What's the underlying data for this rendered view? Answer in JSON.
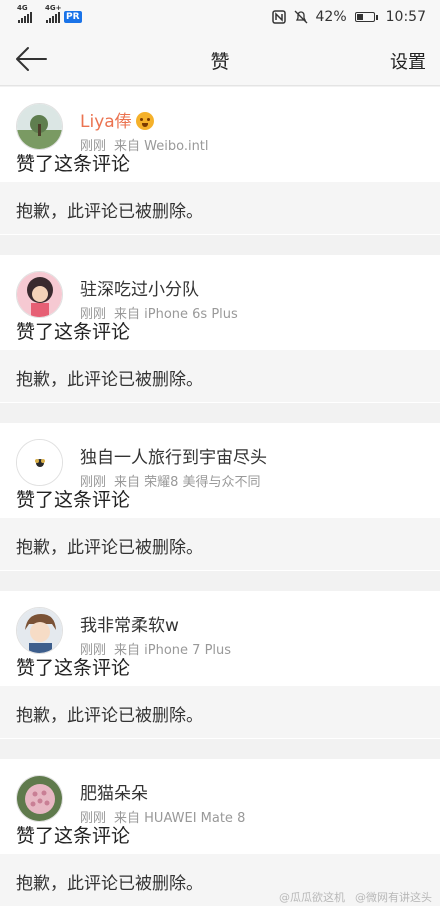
{
  "status_bar": {
    "network_1": "4G",
    "network_2": "4G+",
    "badge": "PR",
    "battery_percent": "42%",
    "battery_level": 0.42,
    "time": "10:57",
    "icons": [
      "signal-icon",
      "nfc-icon",
      "mute-icon",
      "battery-icon"
    ]
  },
  "nav": {
    "title": "赞",
    "settings_label": "设置",
    "back_icon": "back-arrow-icon"
  },
  "items": [
    {
      "name": "Liya俸",
      "time": "刚刚",
      "source": "来自 Weibo.intl",
      "action": "赞了这条评论",
      "comment": "抱歉，此评论已被删除。",
      "name_color": "#eb7350"
    },
    {
      "name": "驻深吃过小分队",
      "time": "刚刚",
      "source": "来自 iPhone 6s Plus",
      "action": "赞了这条评论",
      "comment": "抱歉，此评论已被删除。"
    },
    {
      "name": "独自一人旅行到宇宙尽头",
      "time": "刚刚",
      "source": "来自 荣耀8 美得与众不同",
      "action": "赞了这条评论",
      "comment": "抱歉，此评论已被删除。"
    },
    {
      "name": "我非常柔软w",
      "time": "刚刚",
      "source": "来自 iPhone 7 Plus",
      "action": "赞了这条评论",
      "comment": "抱歉，此评论已被删除。"
    },
    {
      "name": "肥猫朵朵",
      "time": "刚刚",
      "source": "来自 HUAWEI Mate 8",
      "action": "赞了这条评论",
      "comment": "抱歉，此评论已被删除。"
    }
  ],
  "watermark": {
    "left": "@瓜瓜欲这机",
    "right": "@微网有讲这头"
  },
  "colors": {
    "accent": "#eb7350",
    "background": "#f2f2f2",
    "muted_text": "#999999"
  }
}
